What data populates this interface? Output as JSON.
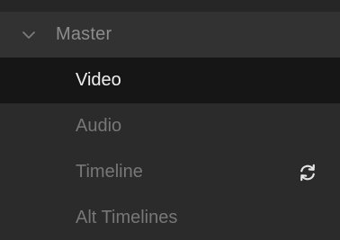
{
  "bin_list": {
    "group": {
      "label": "Master",
      "icon": "chevron-down-icon",
      "expanded": true
    },
    "items": [
      {
        "label": "Video",
        "selected": true
      },
      {
        "label": "Audio",
        "selected": false
      },
      {
        "label": "Timeline",
        "selected": false,
        "icon": "sync-icon"
      },
      {
        "label": "Alt Timelines",
        "selected": false
      }
    ]
  },
  "colors": {
    "background": "#2b2b2b",
    "group_background": "#323232",
    "selected_background": "#161616",
    "selected_text": "#f0f0f0",
    "text": "#777777"
  }
}
